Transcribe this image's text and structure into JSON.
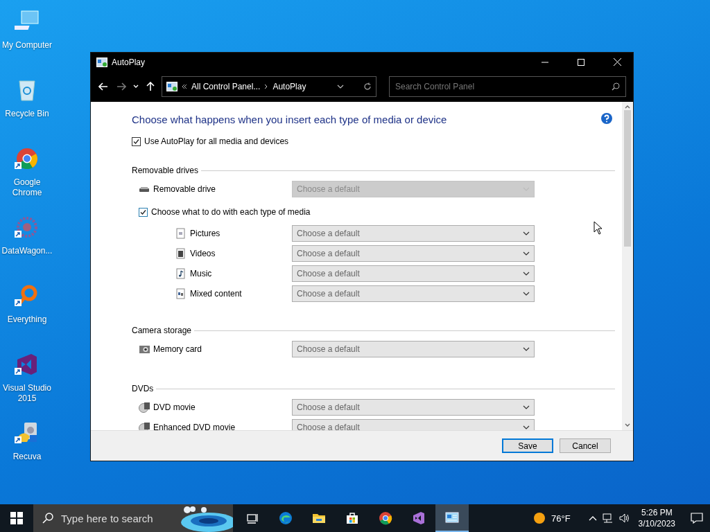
{
  "desktop_icons": [
    {
      "kind": "computer",
      "label": "My Computer",
      "shortcut": false
    },
    {
      "kind": "recycle",
      "label": "Recycle Bin",
      "shortcut": false
    },
    {
      "kind": "chrome",
      "label": "Google Chrome",
      "shortcut": true
    },
    {
      "kind": "datawagon",
      "label": "DataWagon...",
      "shortcut": true
    },
    {
      "kind": "everything",
      "label": "Everything",
      "shortcut": true
    },
    {
      "kind": "vs",
      "label": "Visual Studio 2015",
      "shortcut": true
    },
    {
      "kind": "recuva",
      "label": "Recuva",
      "shortcut": true
    }
  ],
  "window": {
    "title": "AutoPlay",
    "address": [
      "All Control Panel...",
      "AutoPlay"
    ],
    "search": {
      "placeholder": "Search Control Panel"
    },
    "heading": "Choose what happens when you insert each type of media or device",
    "use_autoplay": {
      "label": "Use AutoPlay for all media and devices",
      "checked": true
    },
    "sections": [
      {
        "title": "Removable drives",
        "rows": [
          {
            "kind": "drive",
            "label": "Removable drive",
            "value": "Choose a default",
            "disabled": true
          },
          {
            "kind": "checkbox",
            "label": "Choose what to do with each type of media",
            "checked": true,
            "children": [
              {
                "kind": "picture",
                "label": "Pictures",
                "value": "Choose a default",
                "disabled": false
              },
              {
                "kind": "video",
                "label": "Videos",
                "value": "Choose a default",
                "disabled": false
              },
              {
                "kind": "music",
                "label": "Music",
                "value": "Choose a default",
                "disabled": false
              },
              {
                "kind": "mixed",
                "label": "Mixed content",
                "value": "Choose a default",
                "disabled": false
              }
            ]
          }
        ]
      },
      {
        "title": "Camera storage",
        "rows": [
          {
            "kind": "camera",
            "label": "Memory card",
            "value": "Choose a default",
            "disabled": false
          }
        ]
      },
      {
        "title": "DVDs",
        "rows": [
          {
            "kind": "dvd",
            "label": "DVD movie",
            "value": "Choose a default",
            "disabled": false
          },
          {
            "kind": "dvd",
            "label": "Enhanced DVD movie",
            "value": "Choose a default",
            "disabled": false
          }
        ]
      }
    ],
    "buttons": [
      {
        "label": "Save",
        "default": true
      },
      {
        "label": "Cancel",
        "default": false
      }
    ]
  },
  "taskbar": {
    "search": {
      "placeholder": "Type here to search"
    },
    "apps": [
      {
        "kind": "taskview",
        "active": false
      },
      {
        "kind": "edge",
        "active": false
      },
      {
        "kind": "explorer",
        "active": false
      },
      {
        "kind": "store",
        "active": false
      },
      {
        "kind": "chrome",
        "active": false
      },
      {
        "kind": "vs",
        "active": false
      },
      {
        "kind": "controlpanel",
        "active": true
      }
    ],
    "temperature": "76°F",
    "time": "5:26 PM",
    "date": "3/10/2023"
  }
}
